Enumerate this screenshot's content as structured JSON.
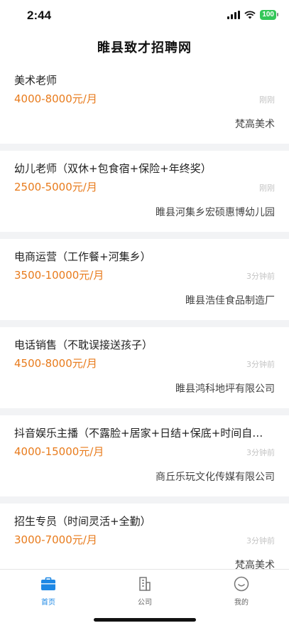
{
  "status": {
    "time": "2:44",
    "battery": "100"
  },
  "header": {
    "title": "睢县致才招聘网"
  },
  "jobs": [
    {
      "title": "美术老师",
      "salary": "4000-8000元/月",
      "time": "刚刚",
      "company": "梵高美术"
    },
    {
      "title": "幼儿老师（双休+包食宿+保险+年终奖）",
      "salary": "2500-5000元/月",
      "time": "刚刚",
      "company": "睢县河集乡宏硕惠博幼儿园"
    },
    {
      "title": "电商运营（工作餐+河集乡）",
      "salary": "3500-10000元/月",
      "time": "3分钟前",
      "company": "睢县浩佳食品制造厂"
    },
    {
      "title": "电话销售（不耽误接送孩子）",
      "salary": "4500-8000元/月",
      "time": "3分钟前",
      "company": "睢县鸿科地坪有限公司"
    },
    {
      "title": "抖音娱乐主播（不露脸+居家+日结+保底+时间自…",
      "salary": "4000-15000元/月",
      "time": "3分钟前",
      "company": "商丘乐玩文化传媒有限公司"
    },
    {
      "title": "招生专员（时间灵活+全勤）",
      "salary": "3000-7000元/月",
      "time": "3分钟前",
      "company": "梵高美术"
    }
  ],
  "tabs": [
    {
      "label": "首页",
      "icon": "briefcase-icon"
    },
    {
      "label": "公司",
      "icon": "building-icon"
    },
    {
      "label": "我的",
      "icon": "smiley-icon"
    }
  ],
  "colors": {
    "accent": "#1e88e5",
    "salary": "#e87b1c",
    "battery": "#34c759"
  }
}
